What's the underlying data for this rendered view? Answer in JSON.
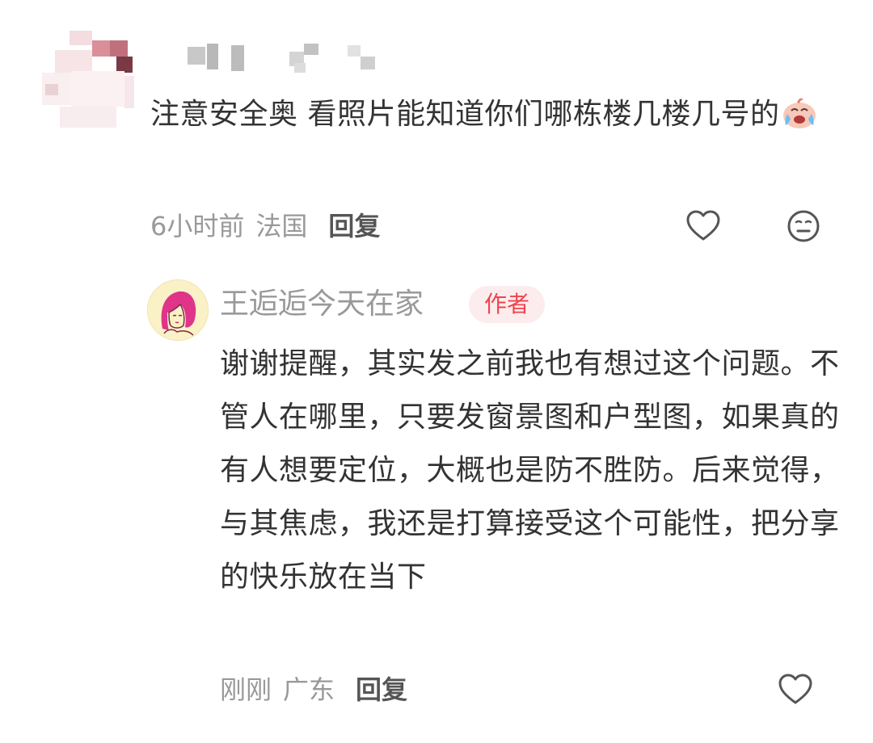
{
  "comment": {
    "text": "注意安全奥 看照片能知道你们哪栋楼几楼几号的",
    "emoji": "cry-laugh-emoji",
    "time": "6小时前",
    "location": "法国",
    "reply_label": "回复",
    "like_icon": "heart-icon",
    "dislike_icon": "meh-face-icon"
  },
  "reply": {
    "author": "王逅逅今天在家",
    "badge": "作者",
    "text": "谢谢提醒，其实发之前我也有想过这个问题。不管人在哪里，只要发窗景图和户型图，如果真的有人想要定位，大概也是防不胜防。后来觉得，与其焦虑，我还是打算接受这个可能性，把分享的快乐放在当下",
    "time": "刚刚",
    "location": "广东",
    "reply_label": "回复",
    "like_icon": "heart-icon"
  },
  "colors": {
    "text": "#333333",
    "meta": "#999999",
    "badge_text": "#f0434e",
    "badge_bg": "#fdeced",
    "reply_avatar_bg": "#fbf1c6"
  }
}
